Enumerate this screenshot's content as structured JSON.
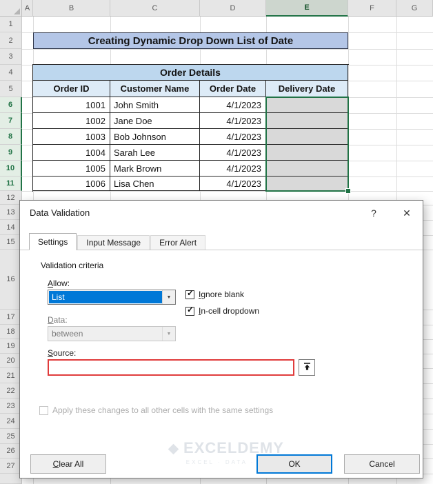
{
  "colors": {
    "accent-green": "#217346",
    "selection-blue": "#0078D7",
    "error-red": "#E03B3B",
    "banner-bg": "#B4C6E7",
    "table-title-bg": "#BDD7EE",
    "table-header-bg": "#DDEBF7",
    "filled-cell-bg": "#D9D9D9"
  },
  "sheet": {
    "column_headers": [
      "A",
      "B",
      "C",
      "D",
      "E",
      "F",
      "G"
    ],
    "selected_column": "E",
    "row_numbers": [
      "1",
      "2",
      "3",
      "4",
      "5",
      "6",
      "7",
      "8",
      "9",
      "10",
      "11",
      "12",
      "13",
      "14",
      "15",
      "16",
      "17",
      "18",
      "19",
      "20",
      "21",
      "22",
      "23",
      "24",
      "25",
      "26",
      "27"
    ],
    "selected_rows": [
      "6",
      "7",
      "8",
      "9",
      "10",
      "11"
    ],
    "banner_title": "Creating Dynamic Drop Down List of Date",
    "table": {
      "title": "Order Details",
      "headers": [
        "Order ID",
        "Customer Name",
        "Order Date",
        "Delivery Date"
      ],
      "rows": [
        [
          "1001",
          "John Smith",
          "4/1/2023",
          ""
        ],
        [
          "1002",
          "Jane Doe",
          "4/1/2023",
          ""
        ],
        [
          "1003",
          "Bob Johnson",
          "4/1/2023",
          ""
        ],
        [
          "1004",
          "Sarah Lee",
          "4/1/2023",
          ""
        ],
        [
          "1005",
          "Mark Brown",
          "4/1/2023",
          ""
        ],
        [
          "1006",
          "Lisa Chen",
          "4/1/2023",
          ""
        ]
      ]
    }
  },
  "dialog": {
    "title": "Data Validation",
    "help_label": "?",
    "close_label": "✕",
    "tabs": [
      "Settings",
      "Input Message",
      "Error Alert"
    ],
    "active_tab": "Settings",
    "criteria_label": "Validation criteria",
    "allow": {
      "label": "Allow:",
      "value": "List"
    },
    "ignore_blank": {
      "label": "Ignore blank",
      "checked": true
    },
    "incell_dropdown": {
      "label": "In-cell dropdown",
      "checked": true
    },
    "data": {
      "label": "Data:",
      "value": "between"
    },
    "source": {
      "label": "Source:",
      "value": ""
    },
    "apply": {
      "label": "Apply these changes to all other cells with the same settings",
      "checked": false
    },
    "watermark": {
      "brand": "EXCELDEMY",
      "tagline": "EXCEL · DATA · BI"
    },
    "buttons": {
      "clear_all": "Clear All",
      "ok": "OK",
      "cancel": "Cancel"
    }
  }
}
